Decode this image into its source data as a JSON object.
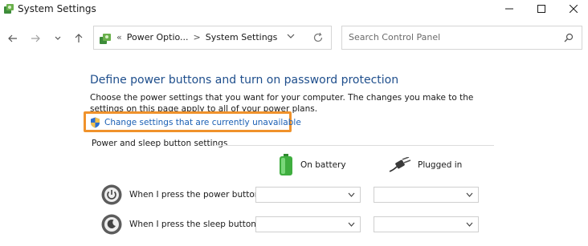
{
  "window": {
    "title": "System Settings",
    "icon": "control-panel-icon"
  },
  "nav": {
    "breadcrumb_prefix": "«",
    "breadcrumb": [
      "Power Optio...",
      "System Settings"
    ],
    "breadcrumb_separator": ">",
    "search_placeholder": "Search Control Panel"
  },
  "main": {
    "title": "Define power buttons and turn on password protection",
    "description": "Choose the power settings that you want for your computer. The changes you make to the settings on this page apply to all of your power plans.",
    "change_link": "Change settings that are currently unavailable",
    "section_header": "Power and sleep button settings",
    "columns": [
      {
        "label": "On battery",
        "icon": "battery-icon"
      },
      {
        "label": "Plugged in",
        "icon": "power-plug-icon"
      }
    ],
    "rows": [
      {
        "label": "When I press the power button:",
        "icon": "power-button-icon",
        "on_battery": "",
        "plugged_in": ""
      },
      {
        "label": "When I press the sleep button:",
        "icon": "sleep-button-icon",
        "on_battery": "",
        "plugged_in": ""
      }
    ]
  },
  "colors": {
    "title_blue": "#1e4e8c",
    "link_blue": "#1a5fb4",
    "highlight_orange": "#f0922b"
  }
}
